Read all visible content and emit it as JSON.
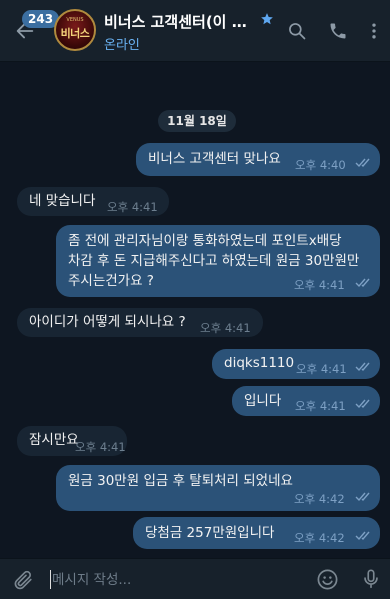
{
  "header": {
    "unread_count": "243",
    "avatar_brand": "비너스",
    "avatar_top": "VENUS",
    "title": "비너스 고객센터(이 계정...",
    "status": "온라인"
  },
  "chat": {
    "date_label": "11월 18일",
    "messages": [
      {
        "dir": "out",
        "text": "비너스 고객센터 맞나요",
        "time": "오후 4:40"
      },
      {
        "dir": "in",
        "text": "네 맞습니다",
        "time": "오후 4:41"
      },
      {
        "dir": "out",
        "text": "좀 전에 관리자님이랑 통화하였는데 포인트x배당\n차감 후 돈 지급해주신다고 하였는데 원금 30만원만\n주시는건가요 ?",
        "time": "오후 4:41"
      },
      {
        "dir": "in",
        "text": "아이디가  어떻게 되시나요 ?",
        "time": "오후 4:41"
      },
      {
        "dir": "out",
        "text": "diqks1110",
        "time": "오후 4:41"
      },
      {
        "dir": "out",
        "text": "입니다",
        "time": "오후 4:41"
      },
      {
        "dir": "in",
        "text": "잠시만요",
        "time": "오후 4:41"
      },
      {
        "dir": "out",
        "text": "원금 30만원 입금 후 탈퇴처리 되었네요",
        "time": "오후 4:42"
      },
      {
        "dir": "out",
        "text": "당첨금 257만원입니다",
        "time": "오후 4:42"
      }
    ]
  },
  "composer": {
    "placeholder": "메시지 작성..."
  },
  "colors": {
    "background": "#0e1621",
    "header": "#17212b",
    "outgoing_bubble": "#2b5278",
    "incoming_bubble": "#182533",
    "accent": "#6ab2f2"
  },
  "icons": [
    "back-arrow-icon",
    "star-icon",
    "search-icon",
    "phone-icon",
    "more-icon",
    "double-check-icon",
    "paperclip-icon",
    "emoji-icon",
    "microphone-icon"
  ]
}
